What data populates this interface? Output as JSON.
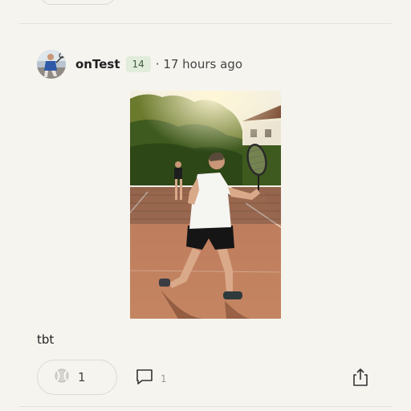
{
  "post": {
    "author": {
      "name": "onTest",
      "badge": "14"
    },
    "time_ago": "· 17 hours ago",
    "caption": "tbt",
    "likes": {
      "count": "1",
      "icon": "tennis-ball-icon"
    },
    "comments": {
      "count": "1",
      "icon": "comment-icon"
    },
    "share": {
      "icon": "share-icon"
    }
  },
  "colors": {
    "background": "#f6f4ef",
    "badge_bg": "#e1ecdb",
    "badge_text": "#3f5b3a",
    "divider": "#e3e1dc"
  }
}
